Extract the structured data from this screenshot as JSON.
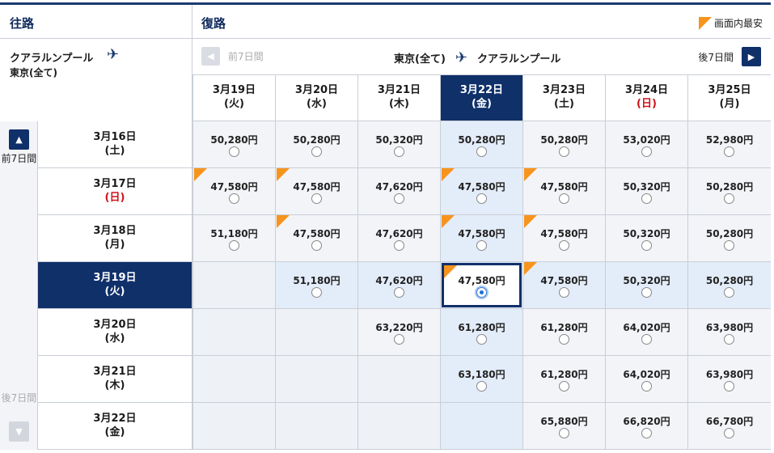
{
  "header": {
    "outbound_title": "往路",
    "return_title": "復路",
    "legend_label": "画面内最安"
  },
  "outbound_route": {
    "origin": "クアラルンプール",
    "destination": "東京(全て)"
  },
  "return_route": {
    "origin": "東京(全て)",
    "destination": "クアラルンプール",
    "prev_label": "前7日間",
    "next_label": "後7日間"
  },
  "side_nav": {
    "prev_label": "前7日間",
    "next_label": "後7日間"
  },
  "colors": {
    "navy": "#10306a",
    "lowest_marker": "#f7941d",
    "sunday": "#d0121b"
  },
  "return_dates": [
    {
      "date": "3月19日",
      "dow": "(火)",
      "sunday": false,
      "selected": false
    },
    {
      "date": "3月20日",
      "dow": "(水)",
      "sunday": false,
      "selected": false
    },
    {
      "date": "3月21日",
      "dow": "(木)",
      "sunday": false,
      "selected": false
    },
    {
      "date": "3月22日",
      "dow": "(金)",
      "sunday": false,
      "selected": true
    },
    {
      "date": "3月23日",
      "dow": "(土)",
      "sunday": false,
      "selected": false
    },
    {
      "date": "3月24日",
      "dow": "(日)",
      "sunday": true,
      "selected": false
    },
    {
      "date": "3月25日",
      "dow": "(月)",
      "sunday": false,
      "selected": false
    }
  ],
  "outbound_dates": [
    {
      "date": "3月16日",
      "dow": "(土)",
      "sunday": false,
      "selected": false
    },
    {
      "date": "3月17日",
      "dow": "(日)",
      "sunday": true,
      "selected": false
    },
    {
      "date": "3月18日",
      "dow": "(月)",
      "sunday": false,
      "selected": false
    },
    {
      "date": "3月19日",
      "dow": "(火)",
      "sunday": false,
      "selected": true
    },
    {
      "date": "3月20日",
      "dow": "(水)",
      "sunday": false,
      "selected": false
    },
    {
      "date": "3月21日",
      "dow": "(木)",
      "sunday": false,
      "selected": false
    },
    {
      "date": "3月22日",
      "dow": "(金)",
      "sunday": false,
      "selected": false
    }
  ],
  "fares": [
    [
      {
        "price": "50,280円",
        "lowest": false
      },
      {
        "price": "50,280円",
        "lowest": false
      },
      {
        "price": "50,320円",
        "lowest": false
      },
      {
        "price": "50,280円",
        "lowest": false
      },
      {
        "price": "50,280円",
        "lowest": false
      },
      {
        "price": "53,020円",
        "lowest": false
      },
      {
        "price": "52,980円",
        "lowest": false
      }
    ],
    [
      {
        "price": "47,580円",
        "lowest": true
      },
      {
        "price": "47,580円",
        "lowest": true
      },
      {
        "price": "47,620円",
        "lowest": false
      },
      {
        "price": "47,580円",
        "lowest": true
      },
      {
        "price": "47,580円",
        "lowest": true
      },
      {
        "price": "50,320円",
        "lowest": false
      },
      {
        "price": "50,280円",
        "lowest": false
      }
    ],
    [
      {
        "price": "51,180円",
        "lowest": false
      },
      {
        "price": "47,580円",
        "lowest": true
      },
      {
        "price": "47,620円",
        "lowest": false
      },
      {
        "price": "47,580円",
        "lowest": true
      },
      {
        "price": "47,580円",
        "lowest": true
      },
      {
        "price": "50,320円",
        "lowest": false
      },
      {
        "price": "50,280円",
        "lowest": false
      }
    ],
    [
      null,
      {
        "price": "51,180円",
        "lowest": false
      },
      {
        "price": "47,620円",
        "lowest": false
      },
      {
        "price": "47,580円",
        "lowest": true,
        "selected": true
      },
      {
        "price": "47,580円",
        "lowest": true
      },
      {
        "price": "50,320円",
        "lowest": false
      },
      {
        "price": "50,280円",
        "lowest": false
      }
    ],
    [
      null,
      null,
      {
        "price": "63,220円",
        "lowest": false
      },
      {
        "price": "61,280円",
        "lowest": false
      },
      {
        "price": "61,280円",
        "lowest": false
      },
      {
        "price": "64,020円",
        "lowest": false
      },
      {
        "price": "63,980円",
        "lowest": false
      }
    ],
    [
      null,
      null,
      null,
      {
        "price": "63,180円",
        "lowest": false
      },
      {
        "price": "61,280円",
        "lowest": false
      },
      {
        "price": "64,020円",
        "lowest": false
      },
      {
        "price": "63,980円",
        "lowest": false
      }
    ],
    [
      null,
      null,
      null,
      null,
      {
        "price": "65,880円",
        "lowest": false
      },
      {
        "price": "66,820円",
        "lowest": false
      },
      {
        "price": "66,780円",
        "lowest": false
      }
    ]
  ]
}
